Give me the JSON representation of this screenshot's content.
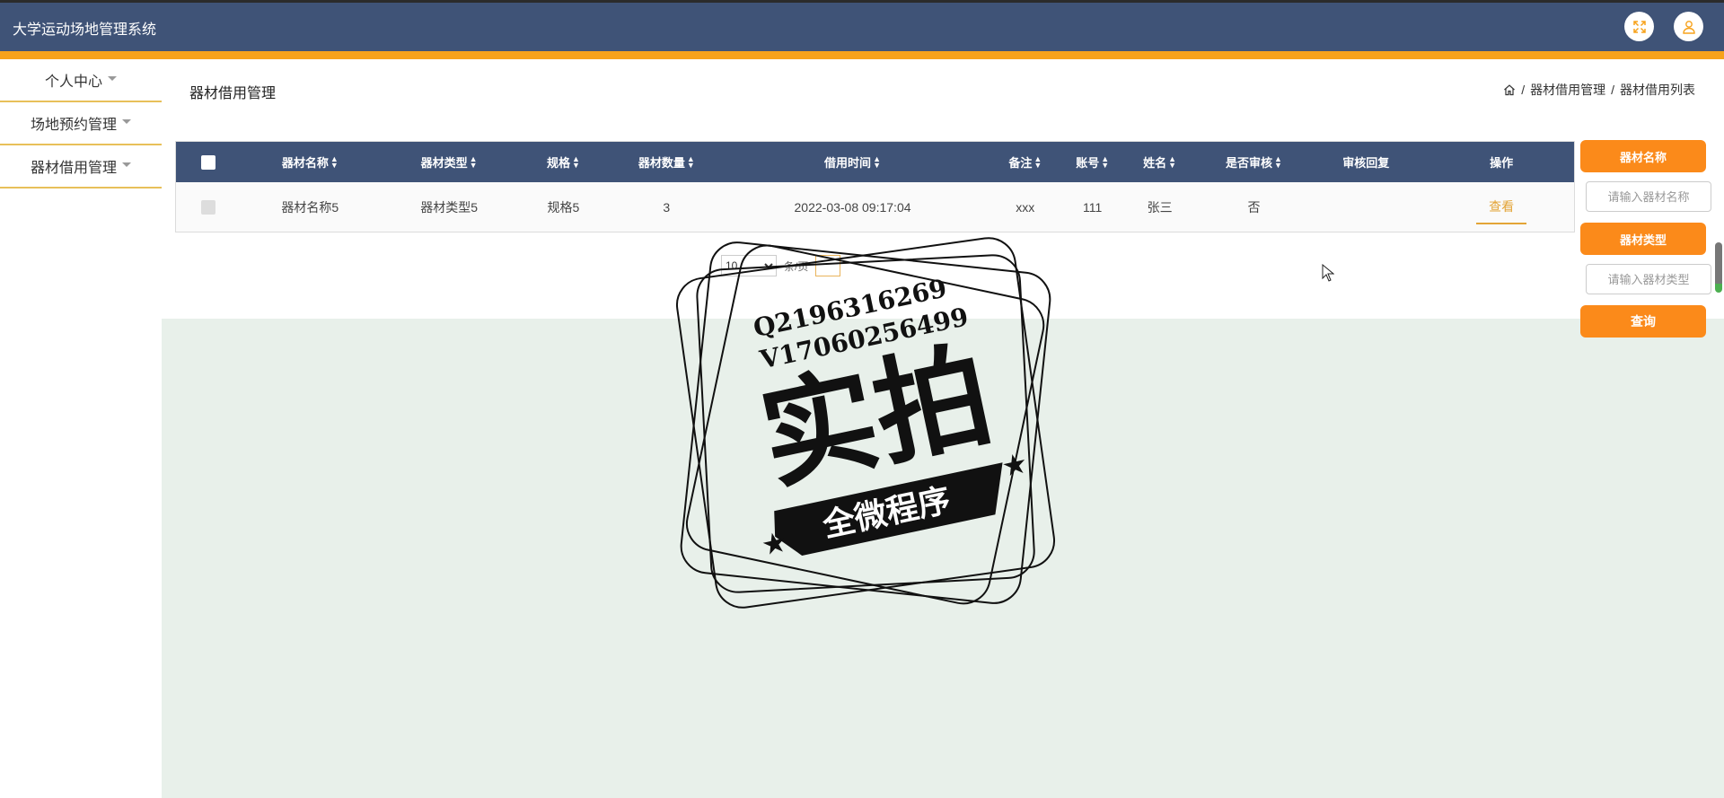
{
  "header": {
    "app_title": "大学运动场地管理系统",
    "icons": [
      "fullscreen-icon",
      "user-icon"
    ]
  },
  "sidebar": {
    "items": [
      {
        "label": "个人中心"
      },
      {
        "label": "场地预约管理"
      },
      {
        "label": "器材借用管理"
      }
    ]
  },
  "page": {
    "title": "器材借用管理",
    "breadcrumb": [
      "器材借用管理",
      "器材借用列表"
    ]
  },
  "table": {
    "columns": [
      "器材名称",
      "器材类型",
      "规格",
      "器材数量",
      "借用时间",
      "备注",
      "账号",
      "姓名",
      "是否审核",
      "审核回复",
      "操作"
    ],
    "sortable": [
      true,
      true,
      true,
      true,
      true,
      true,
      true,
      true,
      true,
      false,
      false
    ],
    "rows": [
      {
        "name": "器材名称5",
        "type": "器材类型5",
        "spec": "规格5",
        "qty": "3",
        "time": "2022-03-08 09:17:04",
        "remark": "xxx",
        "account": "111",
        "person": "张三",
        "reviewed": "否",
        "reply": "",
        "action": "查看"
      }
    ]
  },
  "pagination": {
    "page_size": "10",
    "page_size_label": "条/页"
  },
  "search": {
    "name_label": "器材名称",
    "name_placeholder": "请输入器材名称",
    "type_label": "器材类型",
    "type_placeholder": "请输入器材类型",
    "query_label": "查询"
  },
  "watermark": {
    "line1": "Q2196316269",
    "line2": "V17060256499",
    "big": "实拍",
    "ribbon": "全微程序"
  },
  "colors": {
    "header_bg": "#3f5377",
    "accent_yellow": "#f7a21b",
    "button_orange": "#fb8a1a",
    "link_gold": "#e3a436",
    "panel_green": "#e8f0ea"
  }
}
